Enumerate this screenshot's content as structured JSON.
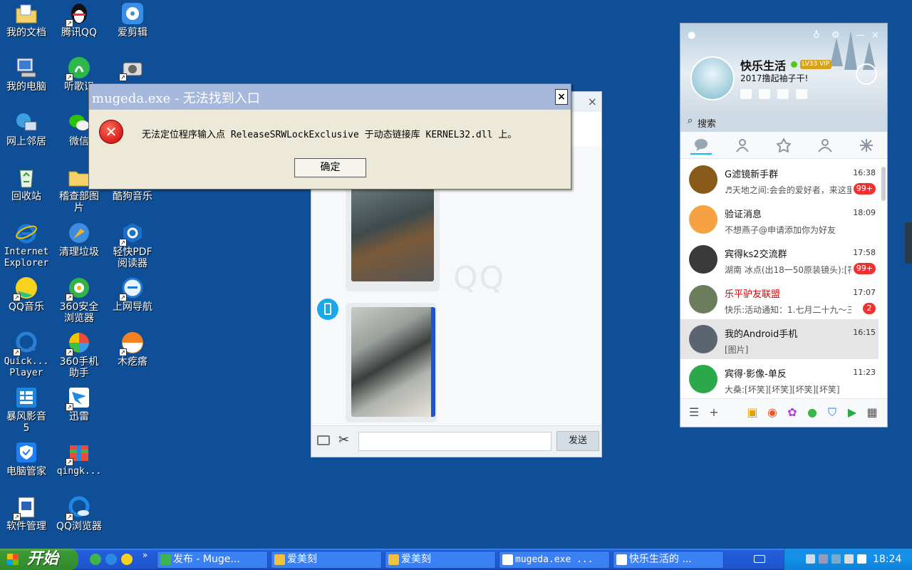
{
  "desktop_icons": [
    {
      "label": "我的文档"
    },
    {
      "label": "腾讯QQ"
    },
    {
      "label": "爱剪辑"
    },
    {
      "label": "我的电脑"
    },
    {
      "label": "听歌识"
    },
    {
      "label": "网上邻居"
    },
    {
      "label": "微信"
    },
    {
      "label": "回收站"
    },
    {
      "label": "稽查部图\n片"
    },
    {
      "label": "酷狗音乐"
    },
    {
      "label": "Internet\nExplorer"
    },
    {
      "label": "清理垃圾"
    },
    {
      "label": "轻快PDF\n阅读器"
    },
    {
      "label": "QQ音乐"
    },
    {
      "label": "360安全\n浏览器"
    },
    {
      "label": "上网导航"
    },
    {
      "label": "Quick...\nPlayer"
    },
    {
      "label": "360手机\n助手"
    },
    {
      "label": "木疙瘩"
    },
    {
      "label": "暴风影音\n5"
    },
    {
      "label": "迅雷"
    },
    {
      "label": "电脑管家"
    },
    {
      "label": "qingk..."
    },
    {
      "label": "软件管理"
    },
    {
      "label": "QQ浏览器"
    }
  ],
  "dialog": {
    "title": "mugeda.exe - 无法找到入口",
    "close": "×",
    "message": "无法定位程序输入点 ReleaseSRWLockExclusive 于动态链接库 KERNEL32.dll 上。",
    "ok_label": "确定"
  },
  "chat": {
    "close": "×",
    "watermark": "QQ",
    "send_label": "发送",
    "input_value": ""
  },
  "qq": {
    "nickname": "快乐生活",
    "level": "LV33 VIP",
    "signature": "2017撸起袖子干!",
    "search_placeholder": "搜索",
    "contacts": [
      {
        "name": "G滤镜新手群",
        "time": "16:38",
        "msg": "♬天地之间:会会的爱好者，来这里",
        "badge": "99+",
        "color": "#8a5a1a"
      },
      {
        "name": "验证消息",
        "time": "18:09",
        "msg": "不想燕子@申请添加你为好友",
        "badge": "",
        "color": "#f6a243"
      },
      {
        "name": "宾得ks2交流群",
        "time": "17:58",
        "msg": "湖南 冰点(出18一50原装镜头):[符",
        "badge": "99+",
        "color": "#3a3a3a"
      },
      {
        "name": "乐平驴友联盟",
        "time": "17:07",
        "msg": "快乐:活动通知：1.七月二十九～三",
        "badge": "2",
        "color": "#6b7d5a"
      },
      {
        "name": "我的Android手机",
        "time": "16:15",
        "msg": "[图片]",
        "badge": "",
        "color": "#5a6570"
      },
      {
        "name": "宾得·影像-单反",
        "time": "11:23",
        "msg": "大桑:[坏笑][坏笑][坏笑][坏笑]",
        "badge": "",
        "color": "#2aa84a"
      }
    ]
  },
  "taskbar": {
    "start_label": "开始",
    "more": "»",
    "tasks": [
      {
        "label": "发布 - Muge...",
        "icon_color": "#3cb54a"
      },
      {
        "label": "爱美刻",
        "icon_color": "#f0c040"
      },
      {
        "label": "爱美刻",
        "icon_color": "#f0c040"
      },
      {
        "label": "mugeda.exe ...",
        "icon_color": "#ffffff"
      },
      {
        "label": "快乐生活的 ...",
        "icon_color": "#ffffff"
      }
    ],
    "clock": "18:24"
  }
}
